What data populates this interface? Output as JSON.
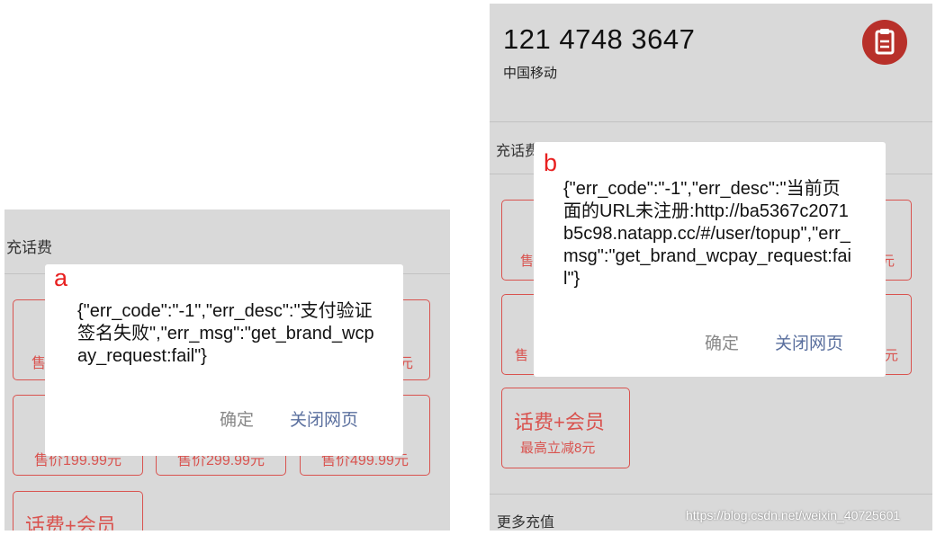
{
  "panel_a": {
    "label": "a",
    "section_title": "充话费",
    "cards": [
      {
        "price_fragment": "售"
      },
      {
        "price_fragment": "元"
      },
      {
        "price_fragment": "售价199.99元"
      },
      {
        "price_fragment": "售价299.99元"
      },
      {
        "price_fragment": "售价499.99元"
      }
    ],
    "combo": {
      "title": "话费+会员"
    },
    "dialog": {
      "message": "{\"err_code\":\"-1\",\"err_desc\":\"支付验证签名失败\",\"err_msg\":\"get_brand_wcpay_request:fail\"}",
      "ok_label": "确定",
      "close_label": "关闭网页"
    }
  },
  "panel_b": {
    "label": "b",
    "phone_number": "121 4748 3647",
    "carrier": "中国移动",
    "order_icon": "clipboard-icon",
    "section_title": "充话费",
    "cards": [
      {
        "price_fragment": "售"
      },
      {
        "price_fragment": "元"
      },
      {
        "price_fragment": "售"
      },
      {
        "price_fragment": "元"
      }
    ],
    "combo": {
      "title": "话费+会员",
      "subtitle": "最高立减8元"
    },
    "more_title": "更多充值",
    "dialog": {
      "message": "{\"err_code\":\"-1\",\"err_desc\":\"当前页面的URL未注册:http://ba5367c2071b5c98.natapp.cc/#/user/topup\",\"err_msg\":\"get_brand_wcpay_request:fail\"}",
      "ok_label": "确定",
      "close_label": "关闭网页"
    }
  },
  "watermark": "https://blog.csdn.net/weixin_40725601",
  "colors": {
    "accent_red": "#d9534f",
    "icon_red": "#b8302a",
    "link_blue": "#5a6f9e",
    "overlay_gray": "#d9d9d9",
    "panel_tag_red": "#e82020"
  }
}
